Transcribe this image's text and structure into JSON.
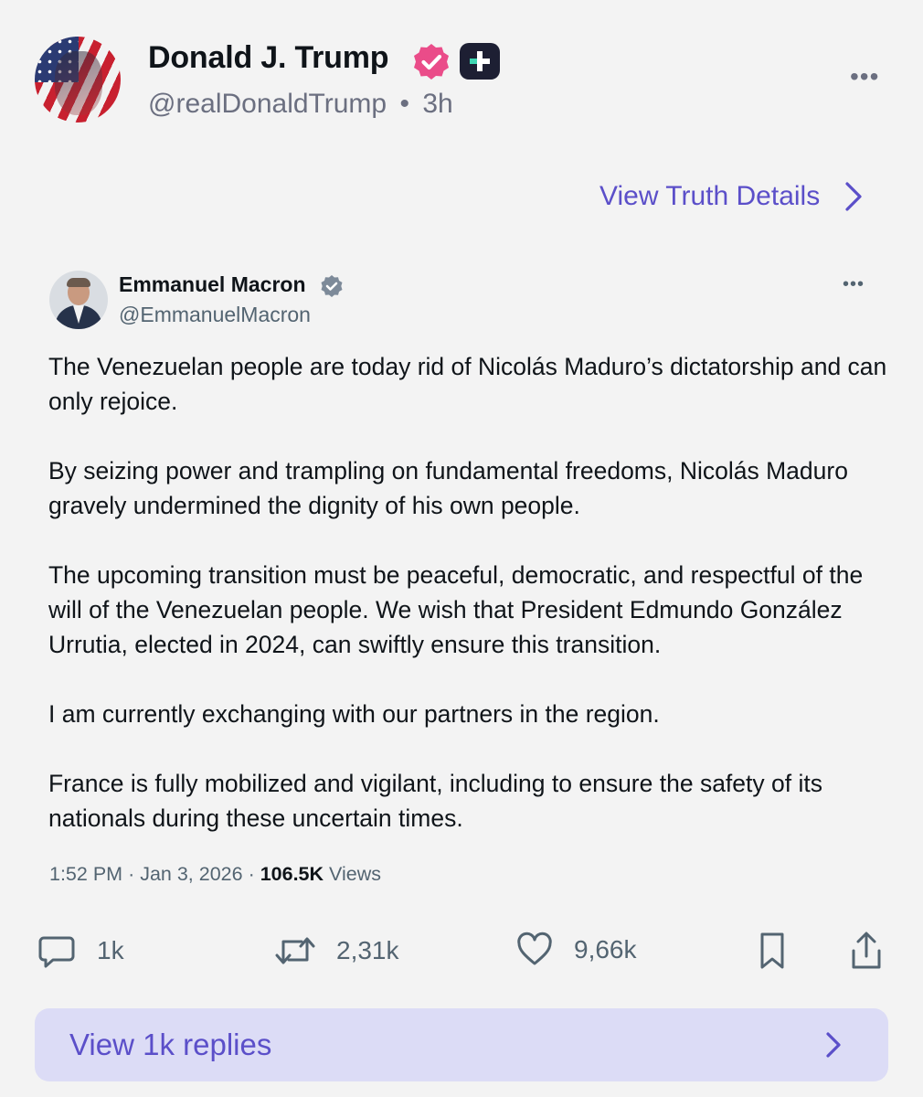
{
  "header": {
    "name": "Donald J. Trump",
    "handle": "@realDonaldTrump",
    "time": "3h",
    "separator": "•",
    "more_label": "•••",
    "verified_badge_color": "#ea4c89"
  },
  "details_link": {
    "label": "View Truth Details"
  },
  "embedded_post": {
    "author_name": "Emmanuel Macron",
    "author_handle": "@EmmanuelMacron",
    "more_label": "•••",
    "paragraphs": [
      "The Venezuelan people are today rid of Nicolás Maduro’s dictatorship and can only rejoice.",
      "By seizing power and trampling on fundamental freedoms, Nicolás Maduro gravely undermined the dignity of his own people.",
      "The upcoming transition must be peaceful, democratic, and respectful of the will of the Venezuelan people. We wish that President Edmundo González Urrutia, elected in 2024, can swiftly ensure this transition.",
      "I am currently exchanging with our partners in the region.",
      "France is fully mobilized and vigilant, including to ensure the safety of its nationals during these uncertain times."
    ],
    "time": "1:52 PM",
    "date": "Jan 3, 2026",
    "views_count": "106.5K",
    "views_label": "Views"
  },
  "actions": {
    "replies": "1k",
    "reposts": "2,31k",
    "likes": "9,66k"
  },
  "replies_bar": {
    "label": "View 1k replies"
  },
  "colors": {
    "accent": "#5b4fc9",
    "muted": "#6b6f80",
    "bar_bg": "#dcdcf6"
  }
}
